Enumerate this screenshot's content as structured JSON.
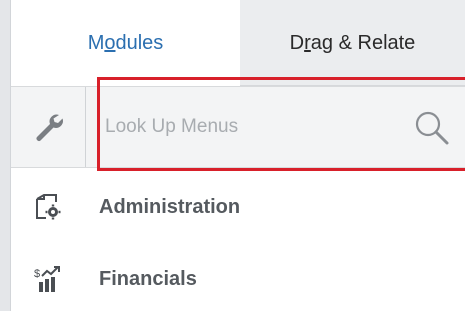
{
  "tabs": [
    {
      "label_pre": "M",
      "label_u": "o",
      "label_post": "dules",
      "active": true
    },
    {
      "label_pre": "D",
      "label_u": "r",
      "label_post": "ag & Relate",
      "active": false
    }
  ],
  "search": {
    "placeholder": "Look Up Menus",
    "value": ""
  },
  "menu": {
    "items": [
      {
        "label": "Administration",
        "icon": "administration-gear-folder-icon"
      },
      {
        "label": "Financials",
        "icon": "financials-chart-icon"
      }
    ]
  },
  "colors": {
    "active_tab_text": "#2b6fb0",
    "highlight": "#d8202a",
    "menu_label": "#555a5f"
  }
}
